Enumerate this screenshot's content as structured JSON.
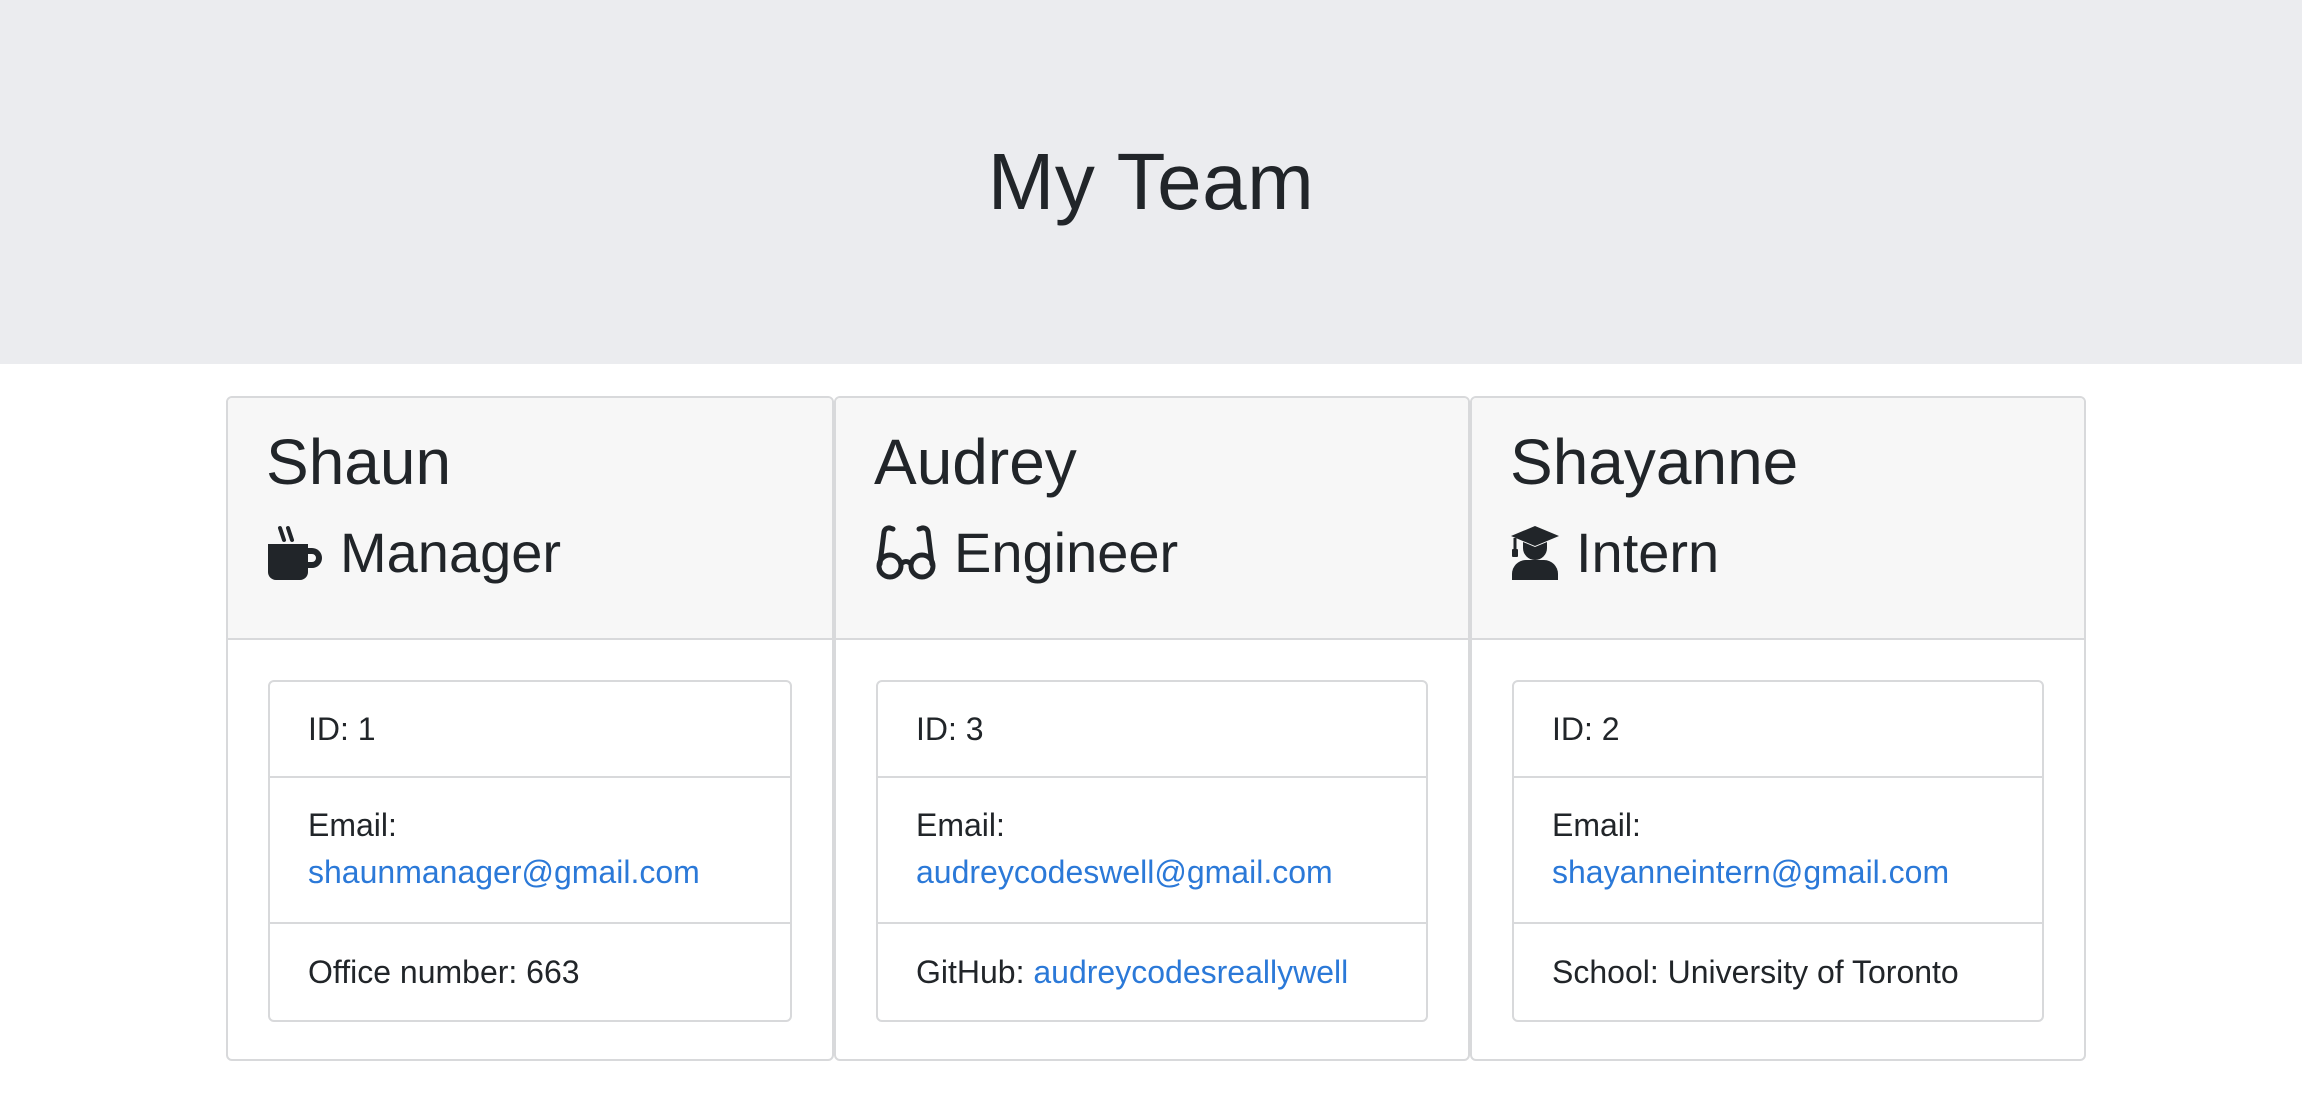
{
  "header": {
    "title": "My Team"
  },
  "cards": [
    {
      "name": "Shaun",
      "role": "Manager",
      "role_icon": "coffee-mug-icon",
      "id_label": "ID:",
      "id_value": "1",
      "email_label": "Email:",
      "email": "shaunmanager@gmail.com",
      "extra_label": "Office number:",
      "extra_value": "663"
    },
    {
      "name": "Audrey",
      "role": "Engineer",
      "role_icon": "glasses-icon",
      "id_label": "ID:",
      "id_value": "3",
      "email_label": "Email:",
      "email": "audreycodeswell@gmail.com",
      "extra_label": "GitHub:",
      "extra_value": "audreycodesreallywell"
    },
    {
      "name": "Shayanne",
      "role": "Intern",
      "role_icon": "graduate-icon",
      "id_label": "ID:",
      "id_value": "2",
      "email_label": "Email:",
      "email": "shayanneintern@gmail.com",
      "extra_label": "School:",
      "extra_value": "University of Toronto"
    }
  ],
  "colors": {
    "header_bg": "#ebecef",
    "card_header_bg": "#f7f7f7",
    "border": "#d8d9db",
    "link": "#2b79d8",
    "text": "#212529"
  }
}
